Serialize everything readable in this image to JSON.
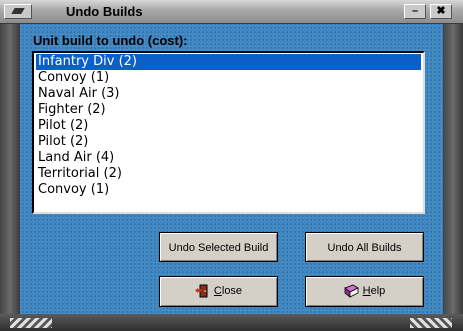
{
  "window": {
    "title": "Undo Builds",
    "minimize_glyph": "–",
    "close_glyph": "✖"
  },
  "prompt": "Unit build to undo (cost):",
  "list": {
    "items": [
      {
        "label": "Infantry Div (2)",
        "selected": true
      },
      {
        "label": "Convoy (1)",
        "selected": false
      },
      {
        "label": "Naval Air (3)",
        "selected": false
      },
      {
        "label": "Fighter (2)",
        "selected": false
      },
      {
        "label": "Pilot (2)",
        "selected": false
      },
      {
        "label": "Pilot (2)",
        "selected": false
      },
      {
        "label": "Land Air (4)",
        "selected": false
      },
      {
        "label": "Territorial (2)",
        "selected": false
      },
      {
        "label": "Convoy (1)",
        "selected": false
      }
    ]
  },
  "buttons": {
    "undo_selected": "Undo Selected Build",
    "undo_all": "Undo All Builds",
    "close_accel": "C",
    "close_rest": "lose",
    "help_accel": "H",
    "help_rest": "elp",
    "close_icon": "door-exit-icon",
    "help_icon": "help-book-icon"
  },
  "colors": {
    "client_bg": "#3a84c0",
    "selection": "#0a5fc8",
    "button_face": "#d4d0c8"
  }
}
